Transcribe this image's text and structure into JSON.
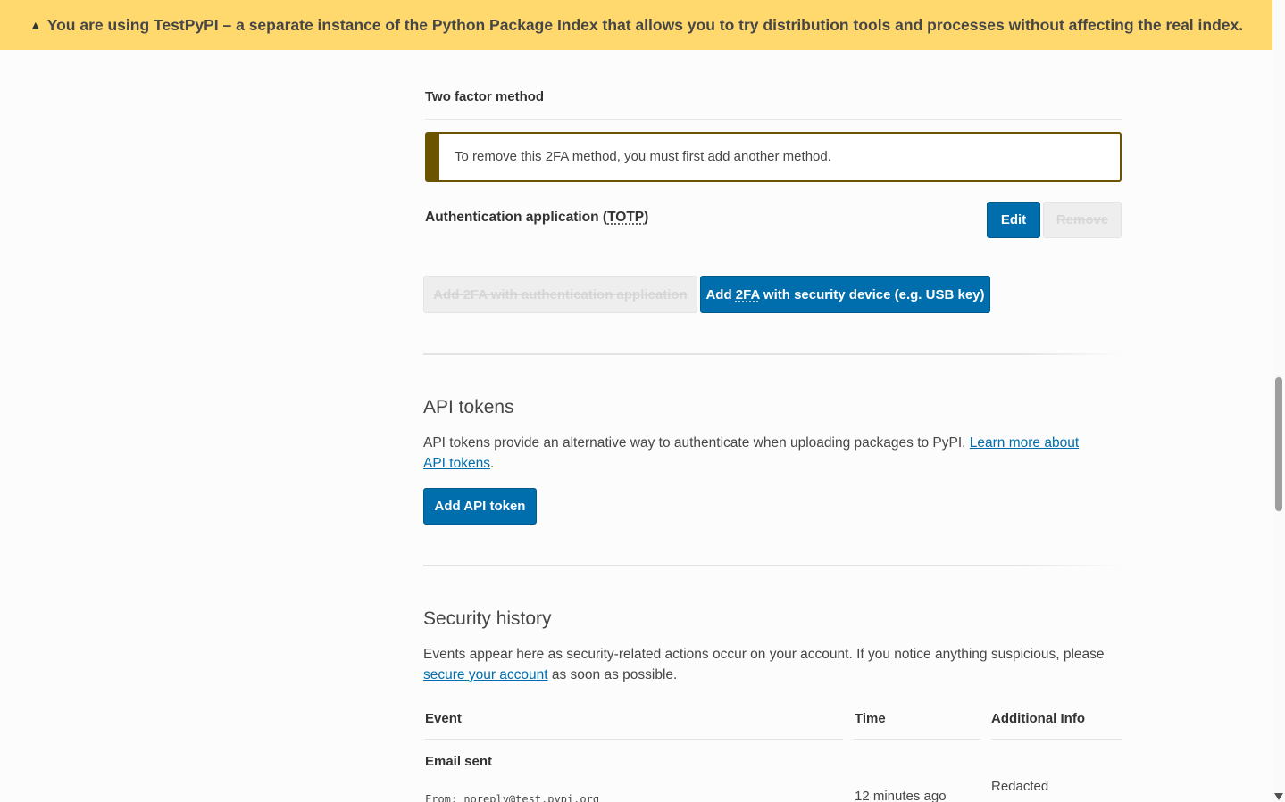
{
  "banner": {
    "icon": "warning-icon",
    "text": "You are using TestPyPI – a separate instance of the Python Package Index that allows you to try distribution tools and processes without affecting the real index."
  },
  "two_factor": {
    "heading": "Two factor method",
    "callout": "To remove this 2FA method, you must first add another method.",
    "method_label_prefix": "Authentication application (",
    "method_label_abbr": "TOTP",
    "method_label_suffix": ")",
    "edit_label": "Edit",
    "remove_label": "Remove",
    "add_auth_app_label": "Add 2FA with authentication application",
    "add_security_device_prefix": "Add ",
    "add_security_device_abbr": "2FA",
    "add_security_device_suffix": " with security device (e.g. USB key)"
  },
  "api_tokens": {
    "heading": "API tokens",
    "description": "API tokens provide an alternative way to authenticate when uploading packages to PyPI. ",
    "link_text": "Learn more about API tokens",
    "after_link": ".",
    "add_button": "Add API token"
  },
  "security_history": {
    "heading": "Security history",
    "description": "Events appear here as security-related actions occur on your account. If you notice anything suspicious, please ",
    "link_text": "secure your account",
    "after_link": " as soon as possible.",
    "columns": [
      "Event",
      "Time",
      "Additional Info"
    ],
    "rows": [
      {
        "event": "Email sent",
        "detail": "From: noreply@test.pypi.org",
        "time": "12 minutes ago",
        "info": "Redacted"
      }
    ]
  },
  "colors": {
    "banner_bg": "#ffd86e",
    "primary": "#006dad",
    "callout_border": "#6b5400"
  }
}
